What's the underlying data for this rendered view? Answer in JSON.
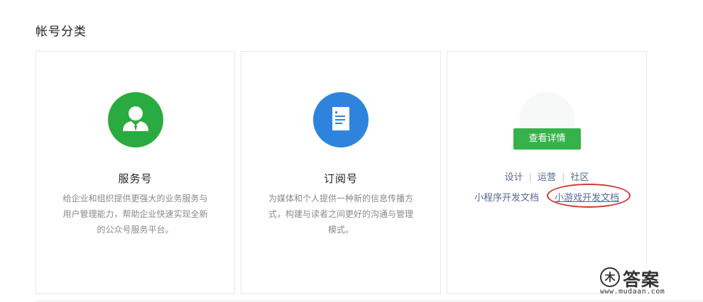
{
  "section": {
    "title": "帐号分类"
  },
  "cards": [
    {
      "title": "服务号",
      "desc": "给企业和组织提供更强大的业务服务与用户管理能力，帮助企业快速实现全新的公众号服务平台。",
      "icon": "person-tie-icon",
      "color": "#2aab3f"
    },
    {
      "title": "订阅号",
      "desc": "为媒体和个人提供一种新的信息传播方式，构建与读者之间更好的沟通与管理模式。",
      "icon": "document-icon",
      "color": "#2e84dc"
    }
  ],
  "miniprogram": {
    "detail_button": "查看详情",
    "links": [
      "设计",
      "运营",
      "社区"
    ],
    "separator": "|",
    "dev_doc": "小程序开发文档",
    "game_doc": "小游戏开发文档"
  },
  "watermark": {
    "logo": "木",
    "text": "答案",
    "url": "www.mudaan.com"
  },
  "colors": {
    "green": "#2aab3f",
    "blue": "#2e84dc",
    "link": "#576b95",
    "highlight": "#d0382f"
  }
}
